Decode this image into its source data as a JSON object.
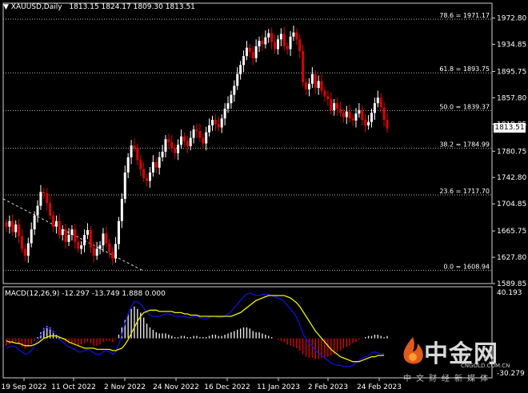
{
  "header": {
    "symbol": "XAUUSD,Daily",
    "ohlc": "1813.15 1824.17 1809.30 1813.51"
  },
  "current_price": "1813.51",
  "price_axis": [
    "1972.80",
    "1934.85",
    "1895.75",
    "1857.80",
    "1819.85",
    "1780.75",
    "1742.80",
    "1704.85",
    "1665.75",
    "1627.80",
    "1589.85"
  ],
  "fib_levels": [
    {
      "label": "78.6 = 1971.17",
      "price": 1971.17
    },
    {
      "label": "61.8 = 1893.75",
      "price": 1893.75
    },
    {
      "label": "50.0 = 1839.37",
      "price": 1839.37
    },
    {
      "label": "38.2 = 1784.99",
      "price": 1784.99
    },
    {
      "label": "23.6 = 1717.70",
      "price": 1717.7
    },
    {
      "label": "0.0 = 1608.94",
      "price": 1608.94
    }
  ],
  "date_axis": [
    "19 Sep 2022",
    "11 Oct 2022",
    "2 Nov 2022",
    "24 Nov 2022",
    "16 Dec 2022",
    "11 Jan 2023",
    "2 Feb 2023",
    "24 Feb 2023"
  ],
  "macd": {
    "header": "MACD(12,26,9) -12.297 -13.749 1.888 0.000",
    "axis_top": "40.193",
    "axis_bottom": "-30.279"
  },
  "logo": {
    "main": "中金网",
    "url": "CNGOLD.COM.CN",
    "sub": "中文财经新媒体"
  },
  "colors": {
    "background": "#000000",
    "bull": "#ffffff",
    "bear": "#e00000",
    "macd_line": "#1010e0",
    "signal_line": "#f0f000"
  },
  "chart_data": {
    "type": "candlestick",
    "ylim": [
      1589.85,
      1985
    ],
    "closes": [
      1672,
      1680,
      1664,
      1675,
      1658,
      1640,
      1630,
      1648,
      1668,
      1688,
      1702,
      1722,
      1720,
      1706,
      1688,
      1672,
      1680,
      1660,
      1668,
      1650,
      1660,
      1668,
      1650,
      1640,
      1645,
      1660,
      1667,
      1642,
      1630,
      1640,
      1645,
      1662,
      1648,
      1635,
      1626,
      1647,
      1680,
      1712,
      1750,
      1772,
      1789,
      1786,
      1768,
      1755,
      1742,
      1738,
      1750,
      1765,
      1757,
      1772,
      1780,
      1798,
      1794,
      1785,
      1778,
      1790,
      1802,
      1795,
      1788,
      1800,
      1812,
      1810,
      1800,
      1792,
      1808,
      1818,
      1826,
      1820,
      1815,
      1828,
      1842,
      1850,
      1862,
      1875,
      1892,
      1905,
      1918,
      1930,
      1924,
      1915,
      1932,
      1940,
      1935,
      1945,
      1951,
      1938,
      1928,
      1942,
      1950,
      1932,
      1928,
      1946,
      1952,
      1942,
      1925,
      1880,
      1870,
      1878,
      1892,
      1872,
      1882,
      1868,
      1860,
      1856,
      1840,
      1850,
      1842,
      1836,
      1830,
      1838,
      1828,
      1825,
      1835,
      1840,
      1826,
      1818,
      1823,
      1836,
      1850,
      1858,
      1844,
      1826,
      1813.51
    ],
    "macd_hist": [
      -6,
      -5,
      -4,
      -3,
      -5,
      -7,
      -8,
      -7,
      -5,
      -2,
      1,
      5,
      8,
      10,
      9,
      6,
      3,
      1,
      -1,
      -3,
      -4,
      -4,
      -5,
      -6,
      -5,
      -4,
      -3,
      -4,
      -6,
      -6,
      -5,
      -3,
      -2,
      -2,
      -3,
      -1,
      3,
      9,
      15,
      20,
      24,
      26,
      24,
      21,
      17,
      12,
      9,
      7,
      5,
      4,
      4,
      4,
      3,
      2,
      1,
      1,
      2,
      2,
      1,
      1,
      2,
      2,
      1,
      1,
      1,
      2,
      3,
      3,
      2,
      2,
      3,
      4,
      5,
      6,
      7,
      8,
      9,
      9,
      8,
      6,
      5,
      5,
      4,
      3,
      2,
      1,
      0,
      -1,
      -2,
      -3,
      -5,
      -6,
      -7,
      -8,
      -10,
      -13,
      -15,
      -16,
      -16,
      -17,
      -17,
      -16,
      -16,
      -15,
      -14,
      -13,
      -11,
      -10,
      -8,
      -7,
      -6,
      -4,
      -3,
      -1,
      0,
      1,
      2,
      2,
      3,
      3,
      2,
      1,
      1.888
    ],
    "macd_line": [
      -8,
      -7,
      -6,
      -7,
      -9,
      -11,
      -13,
      -12,
      -10,
      -6,
      -2,
      3,
      7,
      9,
      8,
      5,
      2,
      -1,
      -3,
      -5,
      -7,
      -8,
      -9,
      -11,
      -11,
      -10,
      -9,
      -10,
      -12,
      -13,
      -13,
      -11,
      -10,
      -11,
      -13,
      -11,
      -5,
      3,
      12,
      20,
      26,
      30,
      30,
      28,
      25,
      21,
      19,
      18,
      18,
      18,
      19,
      20,
      20,
      19,
      18,
      18,
      18,
      18,
      17,
      17,
      18,
      18,
      17,
      16,
      16,
      17,
      18,
      18,
      17,
      17,
      18,
      20,
      22,
      25,
      28,
      31,
      34,
      36,
      37,
      36,
      35,
      35,
      36,
      36,
      36,
      35,
      34,
      33,
      32,
      30,
      27,
      24,
      21,
      17,
      11,
      4,
      -1,
      -4,
      -6,
      -10,
      -12,
      -14,
      -16,
      -18,
      -20,
      -21,
      -22,
      -22,
      -23,
      -23,
      -23,
      -22,
      -20,
      -18,
      -16,
      -15,
      -14,
      -12,
      -11,
      -12,
      -13,
      -12.297
    ],
    "signal_line": [
      -2,
      -3,
      -3,
      -4,
      -4,
      -5,
      -6,
      -6,
      -6,
      -5,
      -4,
      -2,
      0,
      1,
      2,
      2,
      2,
      1,
      0,
      -1,
      -3,
      -4,
      -5,
      -6,
      -7,
      -8,
      -8,
      -8,
      -8,
      -9,
      -9,
      -9,
      -9,
      -9,
      -10,
      -10,
      -9,
      -8,
      -5,
      -1,
      4,
      9,
      14,
      18,
      21,
      22,
      23,
      23,
      23,
      22,
      22,
      22,
      22,
      22,
      21,
      21,
      21,
      20,
      20,
      19,
      19,
      19,
      18,
      18,
      18,
      18,
      18,
      18,
      18,
      18,
      18,
      18,
      18,
      19,
      20,
      21,
      23,
      25,
      27,
      29,
      31,
      32,
      33,
      34,
      35,
      35,
      35,
      35,
      35,
      35,
      34,
      33,
      31,
      29,
      26,
      22,
      18,
      14,
      10,
      6,
      3,
      0,
      -3,
      -6,
      -9,
      -11,
      -13,
      -15,
      -16,
      -17,
      -18,
      -19,
      -19,
      -19,
      -18,
      -17,
      -16,
      -15,
      -15,
      -14,
      -14,
      -13.749
    ],
    "macd_ylim": [
      -30.279,
      40.193
    ]
  }
}
